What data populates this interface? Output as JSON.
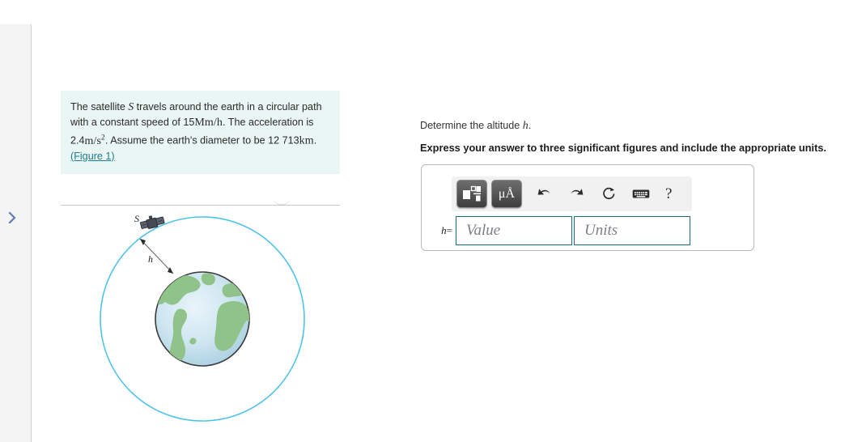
{
  "sidebar": {
    "expander_icon": "chevron-right-icon"
  },
  "problem": {
    "text_part1": "The satellite ",
    "symbol_s": "S",
    "text_part2": " travels around the earth in a circular path with a constant speed of ",
    "speed_value": "15",
    "speed_unit": "Mm/h",
    "text_part3": ". The acceleration is ",
    "accel_value": "2.4",
    "accel_unit": "m/s",
    "accel_unit_sup": "2",
    "text_part4": ". Assume the earth's diameter to be ",
    "diameter_value": "12 713",
    "diameter_unit": "km",
    "text_part5": ". ",
    "figure_link": "(Figure 1)"
  },
  "figure": {
    "satellite_label": "S",
    "altitude_label": "h",
    "orbit_color": "#4ec3ea",
    "earth_ocean_color": "#cfe7f2",
    "earth_land_color": "#8fc389",
    "earth_outline_color": "#3a3a3a",
    "satellite_color": "#4a4f57"
  },
  "question": {
    "prompt_prefix": "Determine the altitude ",
    "prompt_symbol": "h",
    "prompt_suffix": ".",
    "instruction": "Express your answer to three significant figures and include the appropriate units."
  },
  "toolbar": {
    "buttons": [
      {
        "name": "math-template-button",
        "icon": "math-template-icon",
        "label": ""
      },
      {
        "name": "units-button",
        "icon": "mu-angstrom-icon",
        "label": "μÅ"
      },
      {
        "name": "undo-button",
        "icon": "undo-arrow-icon",
        "label": ""
      },
      {
        "name": "redo-button",
        "icon": "redo-arrow-icon",
        "label": ""
      },
      {
        "name": "reset-button",
        "icon": "reset-circular-arrow-icon",
        "label": ""
      },
      {
        "name": "keyboard-button",
        "icon": "keyboard-icon",
        "label": ""
      },
      {
        "name": "help-button",
        "icon": "question-mark-icon",
        "label": "?"
      }
    ],
    "units_label": "μÅ",
    "help_label": "?"
  },
  "answer": {
    "variable_label": "h",
    "equals": "=",
    "value_placeholder": "Value",
    "units_placeholder": "Units"
  }
}
